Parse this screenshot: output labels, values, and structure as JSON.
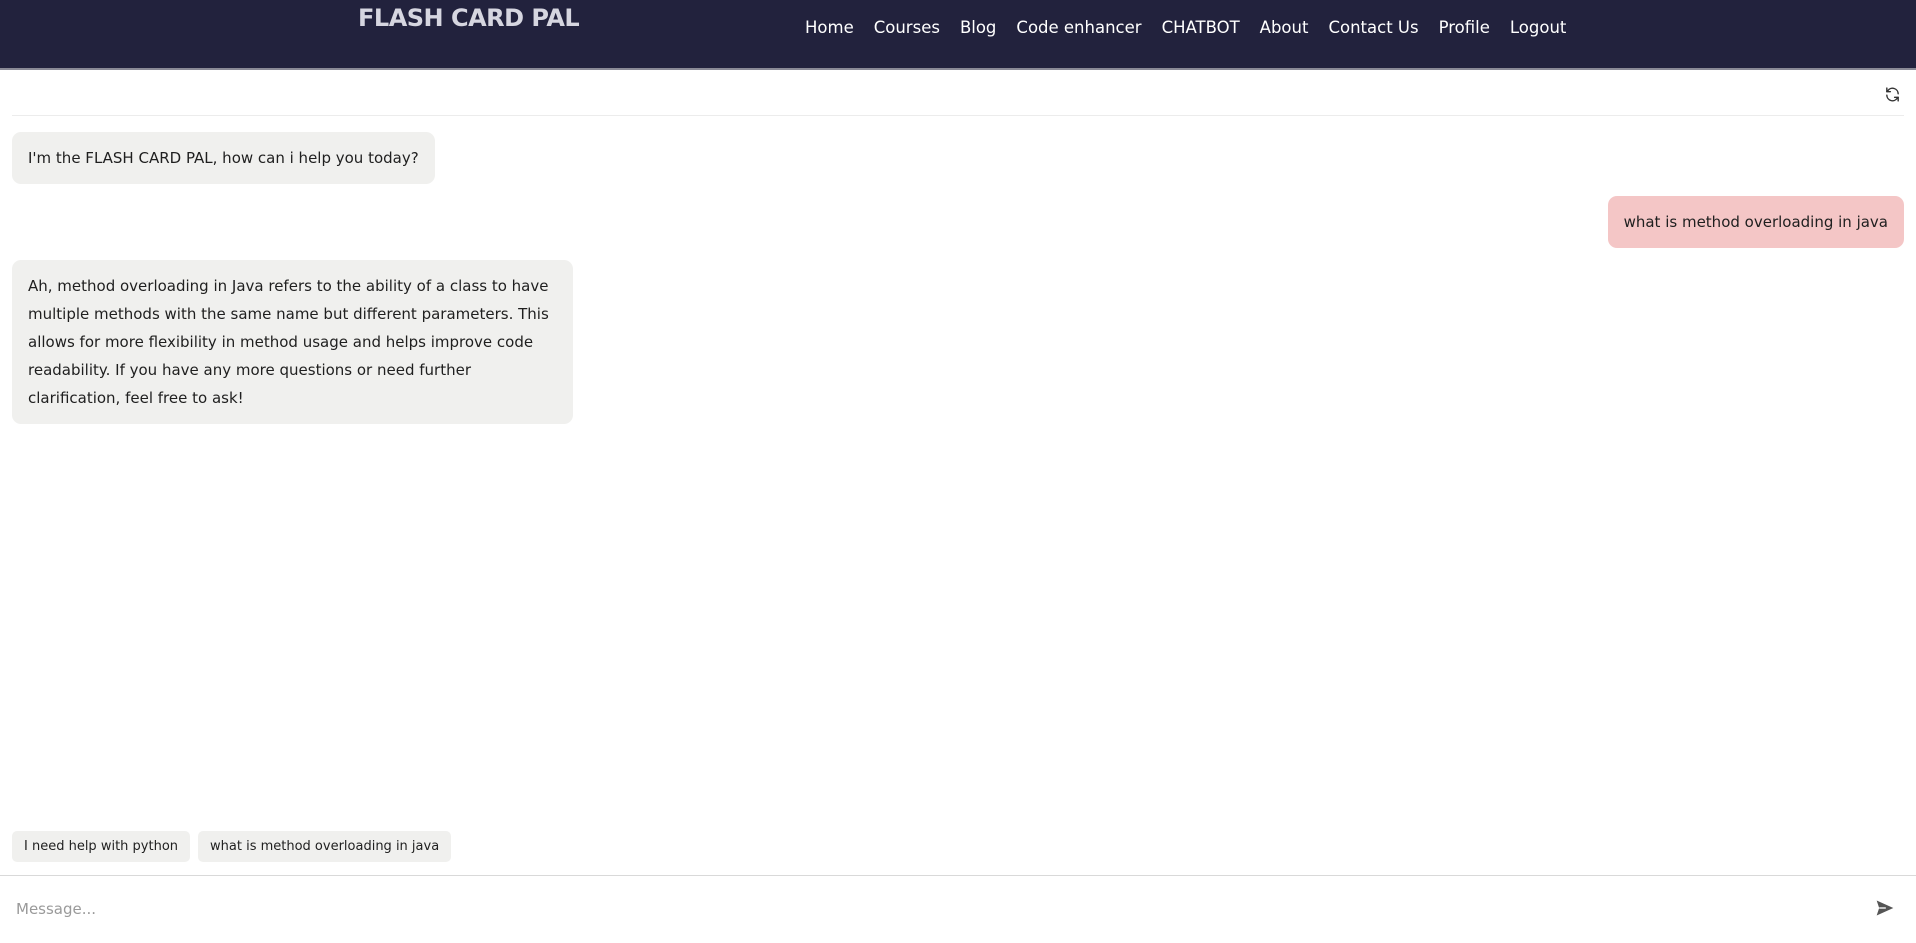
{
  "header": {
    "brand": "FLASH CARD PAL",
    "nav": [
      "Home",
      "Courses",
      "Blog",
      "Code enhancer",
      "CHATBOT",
      "About",
      "Contact Us",
      "Profile",
      "Logout"
    ]
  },
  "toolbar": {
    "refresh_icon": "refresh-icon"
  },
  "messages": [
    {
      "role": "bot",
      "text": "I'm the FLASH CARD PAL, how can i help you today?"
    },
    {
      "role": "user",
      "text": "what is method overloading in java"
    },
    {
      "role": "bot",
      "text": "Ah, method overloading in Java refers to the ability of a class to have multiple methods with the same name but different parameters. This allows for more flexibility in method usage and helps improve code readability. If you have any more questions or need further clarification, feel free to ask!"
    }
  ],
  "suggestions": [
    "I need help with python",
    "what is method overloading in java"
  ],
  "composer": {
    "placeholder": "Message...",
    "value": "",
    "send_icon": "send-icon"
  },
  "colors": {
    "nav_bg": "#22223d",
    "bot_bubble": "#f0f0ee",
    "user_bubble": "#f4c6c6"
  }
}
